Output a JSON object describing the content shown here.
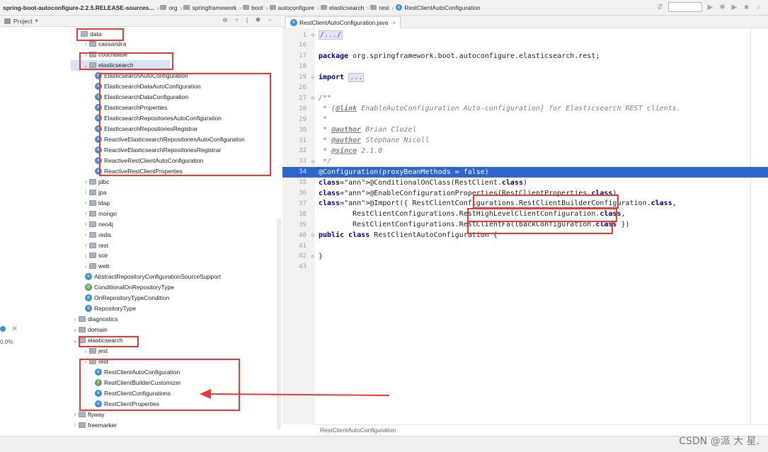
{
  "breadcrumbs": [
    {
      "label": "spring-boot-autoconfigure-2.2.5.RELEASE-sources...",
      "kind": "jar"
    },
    {
      "label": "org",
      "kind": "folder"
    },
    {
      "label": "springframework",
      "kind": "folder"
    },
    {
      "label": "boot",
      "kind": "folder"
    },
    {
      "label": "autoconfigure",
      "kind": "folder"
    },
    {
      "label": "elasticsearch",
      "kind": "folder"
    },
    {
      "label": "rest",
      "kind": "folder"
    },
    {
      "label": "RestClientAutoConfiguration",
      "kind": "class"
    }
  ],
  "project_panel": {
    "title": "Project",
    "dropdown_icon": "chevron-down-icon"
  },
  "tree": {
    "data": "data",
    "cassandra": "cassandra",
    "couchbase": "couchbase",
    "elasticsearch_data": "elasticsearch",
    "data_es_classes": [
      "ElasticsearchAutoConfiguration",
      "ElasticsearchDataAutoConfiguration",
      "ElasticsearchDataConfiguration",
      "ElasticsearchProperties",
      "ElasticsearchRepositoriesAutoConfiguration",
      "ElasticsearchRepositoriesRegistrar",
      "ReactiveElasticsearchRepositoriesAutoConfiguration",
      "ReactiveElasticsearchRepositoriesRegistrar",
      "ReactiveRestClientAutoConfiguration",
      "ReactiveRestClientProperties"
    ],
    "data_packages": [
      "jdbc",
      "jpa",
      "ldap",
      "mongo",
      "neo4j",
      "redis",
      "rest",
      "solr",
      "web"
    ],
    "data_classes": [
      {
        "name": "AbstractRepositoryConfigurationSourceSupport",
        "icon": "c"
      },
      {
        "name": "ConditionalOnRepositoryType",
        "icon": "a"
      },
      {
        "name": "OnRepositoryTypeCondition",
        "icon": "c"
      },
      {
        "name": "RepositoryType",
        "icon": "c"
      }
    ],
    "diagnostics": "diagnostics",
    "domain": "domain",
    "elasticsearch": "elasticsearch",
    "jest": "jest",
    "rest": "rest",
    "rest_classes": [
      {
        "name": "RestClientAutoConfiguration",
        "icon": "c"
      },
      {
        "name": "RestClientBuilderCustomizer",
        "icon": "i"
      },
      {
        "name": "RestClientConfigurations",
        "icon": "c"
      },
      {
        "name": "RestClientProperties",
        "icon": "c"
      }
    ],
    "flyway": "flyway",
    "freemarker": "freemarker"
  },
  "left_edge_fragment": "0.0%",
  "editor": {
    "tab": "RestClientAutoConfiguration.java",
    "lines": [
      {
        "n": "1",
        "text": "/.../"
      },
      {
        "n": "16",
        "text": ""
      },
      {
        "n": "17",
        "text": "package org.springframework.boot.autoconfigure.elasticsearch.rest;"
      },
      {
        "n": "18",
        "text": ""
      },
      {
        "n": "19",
        "text": "import ..."
      },
      {
        "n": "26",
        "text": ""
      },
      {
        "n": "27",
        "text": "/**"
      },
      {
        "n": "28",
        "text": " * {@link EnableAutoConfiguration Auto-configuration} for Elasticsearch REST clients."
      },
      {
        "n": "29",
        "text": " *"
      },
      {
        "n": "30",
        "text": " * @author Brian Clozel"
      },
      {
        "n": "31",
        "text": " * @author Stephane Nicoll"
      },
      {
        "n": "32",
        "text": " * @since 2.1.0"
      },
      {
        "n": "33",
        "text": " */"
      },
      {
        "n": "34",
        "text": "@Configuration(proxyBeanMethods = false)"
      },
      {
        "n": "35",
        "text": "@ConditionalOnClass(RestClient.class)"
      },
      {
        "n": "36",
        "text": "@EnableConfigurationProperties(RestClientProperties.class)"
      },
      {
        "n": "37",
        "text": "@Import({ RestClientConfigurations.RestClientBuilderConfiguration.class,"
      },
      {
        "n": "38",
        "text": "        RestClientConfigurations.RestHighLevelClientConfiguration.class,"
      },
      {
        "n": "39",
        "text": "        RestClientConfigurations.RestClientFallbackConfiguration.class })"
      },
      {
        "n": "40",
        "text": "public class RestClientAutoConfiguration {"
      },
      {
        "n": "41",
        "text": ""
      },
      {
        "n": "42",
        "text": "}"
      },
      {
        "n": "43",
        "text": ""
      }
    ],
    "highlighted_line": "34",
    "bottom_breadcrumb": "RestClientAutoConfiguration"
  },
  "watermark": "CSDN @派 大 星.",
  "colors": {
    "annotation_red": "#e53935",
    "selection_blue": "#2f65ca",
    "keyword": "#000080"
  }
}
